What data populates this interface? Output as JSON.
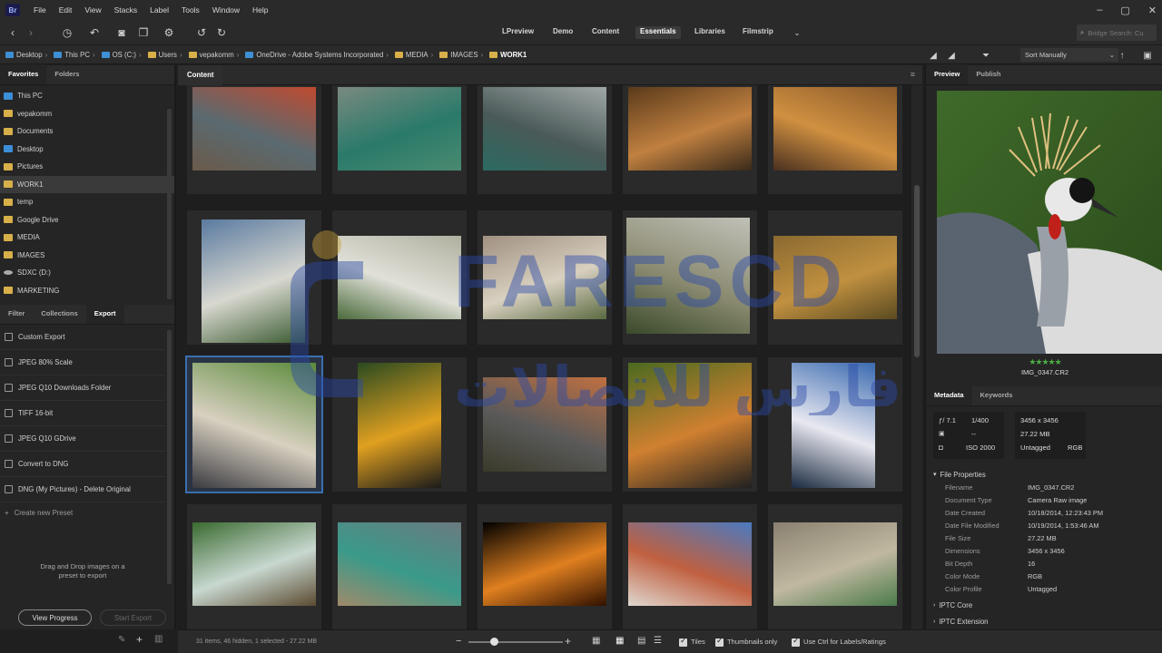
{
  "menu": [
    "File",
    "Edit",
    "View",
    "Stacks",
    "Label",
    "Tools",
    "Window",
    "Help"
  ],
  "workspaces": [
    "LPreview",
    "Demo",
    "Content",
    "Essentials",
    "Libraries",
    "Filmstrip"
  ],
  "search": {
    "placeholder": "Bridge Search: Cu"
  },
  "breadcrumb": [
    "Desktop",
    "This PC",
    "OS (C:)",
    "Users",
    "vepakomm",
    "OneDrive - Adobe Systems Incorporated",
    "MEDIA",
    "IMAGES",
    "WORK1"
  ],
  "sort": {
    "label": "Sort Manually"
  },
  "left_tabs": {
    "favorites": "Favorites",
    "folders": "Folders"
  },
  "favorites": [
    "This PC",
    "vepakomm",
    "Documents",
    "Desktop",
    "Pictures",
    "WORK1",
    "temp",
    "Google Drive",
    "MEDIA",
    "IMAGES",
    "SDXC (D:)",
    "MARKETING"
  ],
  "bottom_tabs": {
    "filter": "Filter",
    "collections": "Collections",
    "export": "Export"
  },
  "export_presets": [
    "Custom Export",
    "JPEG 80% Scale",
    "JPEG Q10 Downloads Folder",
    "TIFF 16-bit",
    "JPEG Q10 GDrive",
    "Convert to DNG",
    "DNG (My Pictures) - Delete Original"
  ],
  "create_preset": "Create new Preset",
  "drop_hint_1": "Drag and Drop images on a",
  "drop_hint_2": "preset to export",
  "buttons": {
    "view_progress": "View Progress",
    "start_export": "Start Export"
  },
  "content_tab": "Content",
  "status": {
    "summary": "31 items, 46 hidden, 1 selected - 27.22 MB",
    "tiles": "Tiles",
    "thumbnails_only": "Thumbnails only",
    "use_ctrl": "Use Ctrl for Labels/Ratings"
  },
  "right_tabs": {
    "preview": "Preview",
    "publish": "Publish",
    "metadata": "Metadata",
    "keywords": "Keywords"
  },
  "preview": {
    "filename": "IMG_0347.CR2",
    "stars": "★★★★★",
    "rating": 5
  },
  "camera": {
    "aperture": "ƒ/ 7.1",
    "shutter": "1/400",
    "ev": "--",
    "iso": "ISO 2000",
    "dimensions": "3456 x 3456",
    "size": "27.22 MB",
    "profile": "Untagged",
    "mode": "RGB"
  },
  "file_properties_title": "File Properties",
  "file_properties": [
    {
      "k": "Filename",
      "v": "IMG_0347.CR2"
    },
    {
      "k": "Document Type",
      "v": "Camera Raw image"
    },
    {
      "k": "Date Created",
      "v": "10/18/2014, 12:23:43 PM"
    },
    {
      "k": "Date File Modified",
      "v": "10/19/2014, 1:53:46 AM"
    },
    {
      "k": "File Size",
      "v": "27.22 MB"
    },
    {
      "k": "Dimensions",
      "v": "3456 x 3456"
    },
    {
      "k": "Bit Depth",
      "v": "16"
    },
    {
      "k": "Color Mode",
      "v": "RGB"
    },
    {
      "k": "Color Profile",
      "v": "Untagged"
    }
  ],
  "iptc_core": "IPTC Core",
  "iptc_ext": "IPTC Extension",
  "watermark_text": "FARESCD",
  "watermark_arabic": "فارس للاتصالات",
  "thumbnails": [
    {
      "name": "waterfall-sunset",
      "c1": "#c04a30",
      "c2": "#5a6a70",
      "c3": "#6a5a4a"
    },
    {
      "name": "halong-bay",
      "c1": "#7a8a80",
      "c2": "#2a7a6a",
      "c3": "#4a8a70"
    },
    {
      "name": "halong-boat",
      "c1": "#a0a8a8",
      "c2": "#4a5a58",
      "c3": "#2a6a60"
    },
    {
      "name": "cave-rocks",
      "c1": "#5a3a1a",
      "c2": "#c08040",
      "c3": "#3a2a1a"
    },
    {
      "name": "cave-light",
      "c1": "#8a5a2a",
      "c2": "#d09040",
      "c3": "#4a3020"
    },
    {
      "name": "iguazu-1",
      "c1": "#5a7aa0",
      "c2": "#d8d8d0",
      "c3": "#3a5a30"
    },
    {
      "name": "iguazu-2",
      "c1": "#b0b0a0",
      "c2": "#e0e0d8",
      "c3": "#4a6a3a"
    },
    {
      "name": "iguazu-3",
      "c1": "#a09080",
      "c2": "#d8d0c0",
      "c3": "#5a6a40"
    },
    {
      "name": "iguazu-mist",
      "c1": "#c0c0b8",
      "c2": "#8a8a70",
      "c3": "#3a4a2a"
    },
    {
      "name": "mandarin-duck",
      "c1": "#8a6a30",
      "c2": "#c09040",
      "c3": "#5a4a20"
    },
    {
      "name": "crowned-crane",
      "c1": "#5a8a3a",
      "c2": "#d8d0c0",
      "c3": "#3a3a40"
    },
    {
      "name": "toucan-orange",
      "c1": "#2a4a20",
      "c2": "#e0a020",
      "c3": "#1a1a1a"
    },
    {
      "name": "mountain-sunset",
      "c1": "#c07040",
      "c2": "#5a5a5a",
      "c3": "#3a3a2a"
    },
    {
      "name": "toucan-branch",
      "c1": "#4a6a20",
      "c2": "#d08030",
      "c3": "#202020"
    },
    {
      "name": "snowy-peak",
      "c1": "#3a6ab0",
      "c2": "#e8e8f0",
      "c3": "#1a2a40"
    },
    {
      "name": "tropical-falls",
      "c1": "#3a6a30",
      "c2": "#c8d8d0",
      "c3": "#5a4a30"
    },
    {
      "name": "river-town",
      "c1": "#6a7a80",
      "c2": "#3a9a8a",
      "c3": "#a08a6a"
    },
    {
      "name": "night-palace",
      "c1": "#000000",
      "c2": "#e08020",
      "c3": "#301000"
    },
    {
      "name": "humayun-tomb",
      "c1": "#4a7ac0",
      "c2": "#c06040",
      "c3": "#e0d8d0"
    },
    {
      "name": "stepwell",
      "c1": "#8a8070",
      "c2": "#c0b8a0",
      "c3": "#4a7a4a"
    }
  ]
}
